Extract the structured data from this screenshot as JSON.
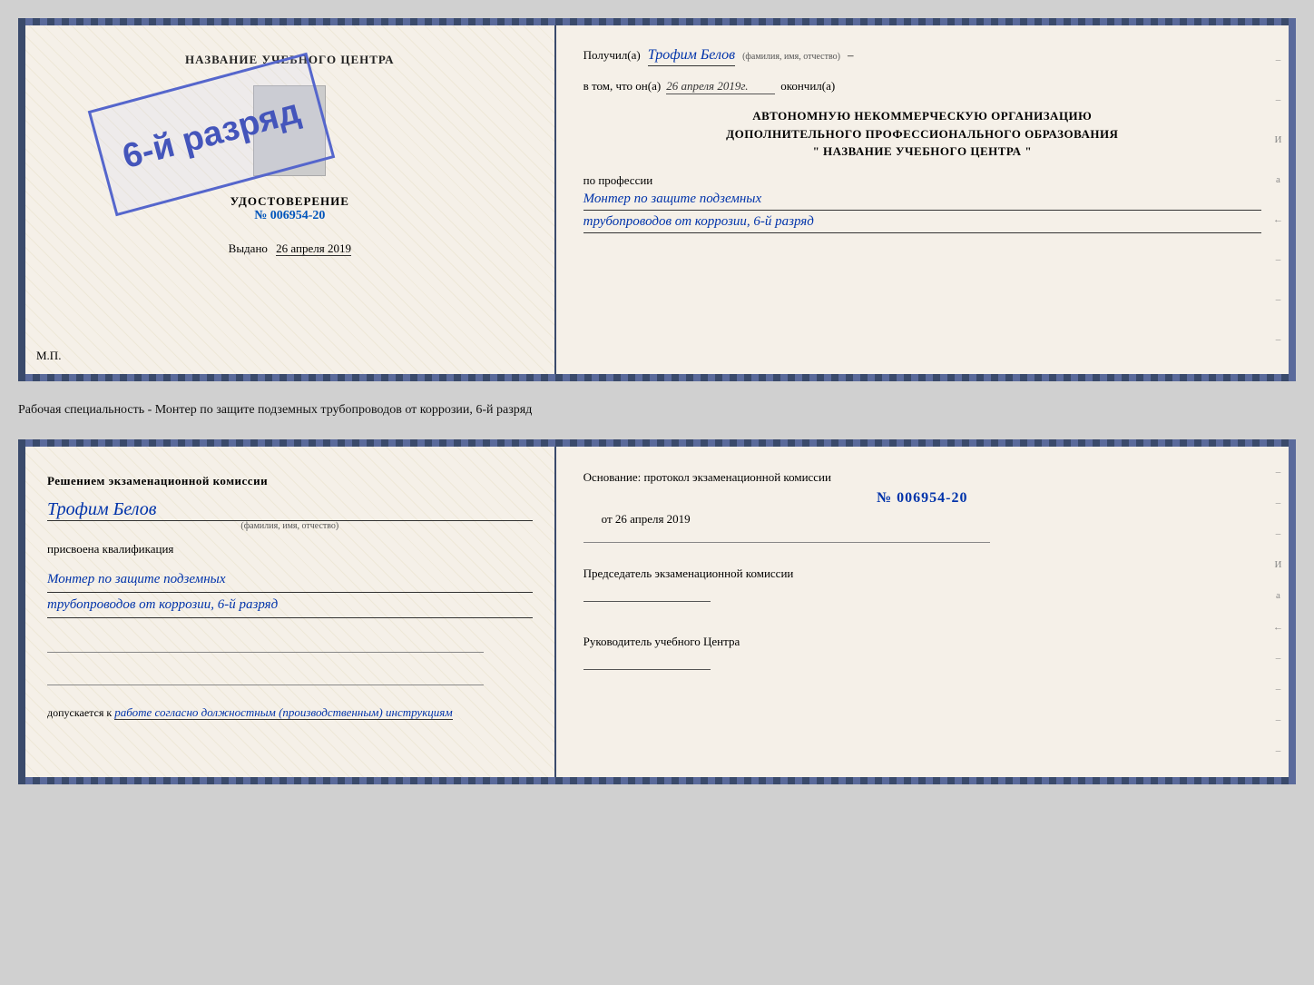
{
  "top_cert": {
    "left": {
      "title": "НАЗВАНИЕ УЧЕБНОГО ЦЕНТРА",
      "udost_title": "УДОСТОВЕРЕНИЕ",
      "udost_num": "№ 006954-20",
      "vydano_label": "Выдано",
      "vydano_date": "26 апреля 2019",
      "mp": "М.П.",
      "stamp_text": "6-й разряд"
    },
    "right": {
      "poluchil_prefix": "Получил(а)",
      "poluchil_name": "Трофим Белов",
      "poluchil_hint": "(фамилия, имя, отчество)",
      "dash1": "–",
      "vtom_prefix": "в том, что он(а)",
      "vtom_date": "26 апреля 2019г.",
      "okончил": "окончил(а)",
      "org_line1": "АВТОНОМНУЮ НЕКОММЕРЧЕСКУЮ ОРГАНИЗАЦИЮ",
      "org_line2": "ДОПОЛНИТЕЛЬНОГО ПРОФЕССИОНАЛЬНОГО ОБРАЗОВАНИЯ",
      "org_line3": "\"  НАЗВАНИЕ УЧЕБНОГО ЦЕНТРА  \"",
      "i_suffix": "И",
      "a_suffix": "а",
      "arrow": "←",
      "po_professii": "по профессии",
      "profession_line1": "Монтер по защите подземных",
      "profession_line2": "трубопроводов от коррозии, 6-й разряд"
    }
  },
  "middle_label": "Рабочая специальность - Монтер по защите подземных трубопроводов от коррозии, 6-й разряд",
  "bottom_cert": {
    "left": {
      "reshenie_title": "Решением экзаменационной комиссии",
      "fio_name": "Трофим Белов",
      "fio_hint": "(фамилия, имя, отчество)",
      "prisvoe_label": "присвоена квалификация",
      "kvalif_line1": "Монтер по защите подземных",
      "kvalif_line2": "трубопроводов от коррозии, 6-й разряд",
      "dopusk_prefix": "допускается к",
      "dopusk_text": "работе согласно должностным (производственным) инструкциям"
    },
    "right": {
      "osnovanie_label": "Основание: протокол экзаменационной комиссии",
      "prot_num": "№ 006954-20",
      "prot_ot": "от",
      "prot_date": "26 апреля 2019",
      "predsedatel_label": "Председатель экзаменационной комиссии",
      "rukovod_label": "Руководитель учебного Центра",
      "i_suffix": "И",
      "a_suffix": "а",
      "arrow": "←",
      "dash_marks": [
        "–",
        "–",
        "–",
        "–",
        "–",
        "–",
        "–"
      ]
    }
  }
}
